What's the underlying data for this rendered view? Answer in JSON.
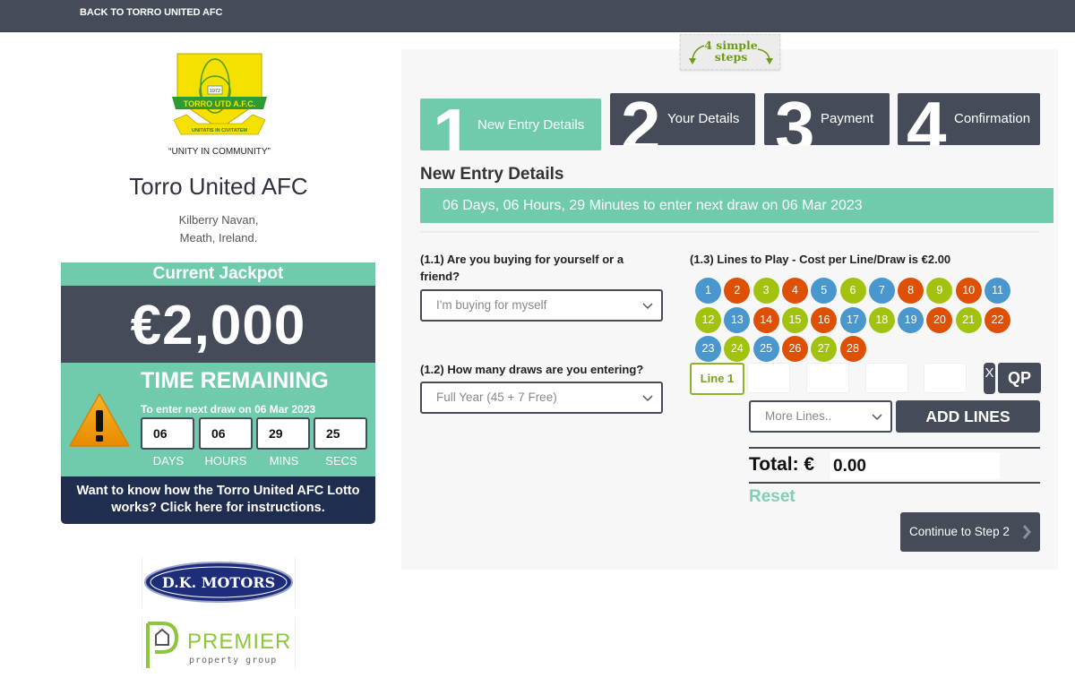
{
  "topbar": {
    "back_link": "BACK TO TORRO UNITED AFC"
  },
  "club": {
    "logo": {
      "year": "1972",
      "banner": "TORRO UTD A.F.C.",
      "motto": "UNITATIS IN CIVITATEM",
      "tagline": "“UNITY IN COMMUNITY”"
    },
    "name": "Torro United AFC",
    "address_line1": "Kilberry Navan,",
    "address_line2": "Meath, Ireland."
  },
  "jackpot": {
    "title": "Current Jackpot",
    "amount": "€2,000",
    "time_remaining_title": "TIME REMAINING",
    "next_draw_text": "To enter next draw on 06 Mar 2023",
    "countdown": [
      {
        "value": "06",
        "label": "DAYS"
      },
      {
        "value": "06",
        "label": "HOURS"
      },
      {
        "value": "29",
        "label": "MINS"
      },
      {
        "value": "25",
        "label": "SECS"
      }
    ],
    "info_link": "Want to know how the Torro United AFC Lotto works? Click here for instructions."
  },
  "sponsors": [
    {
      "name": "D.K. MOTORS"
    },
    {
      "name": "PREMIER",
      "subtitle": "property group"
    }
  ],
  "steps_badge": {
    "line1": "4 simple",
    "line2": "steps"
  },
  "steps": [
    {
      "number": "1",
      "label": "New Entry Details",
      "active": true
    },
    {
      "number": "2",
      "label": "Your Details",
      "active": false
    },
    {
      "number": "3",
      "label": "Payment",
      "active": false
    },
    {
      "number": "4",
      "label": "Confirmation",
      "active": false
    }
  ],
  "form": {
    "section_title": "New Entry Details",
    "draw_banner": "06 Days, 06 Hours, 29 Minutes to enter next draw on 06 Mar 2023",
    "q1": {
      "label": "(1.1) Are you buying for yourself or a friend?",
      "selected": "I'm buying for myself"
    },
    "q2": {
      "label": "(1.2) How many draws are you entering?",
      "selected": "Full Year (45 + 7 Free)"
    },
    "q3": {
      "label": "(1.3) Lines to Play - Cost per Line/Draw is €2.00"
    },
    "ball_colors": {
      "blue": "#4a97cd",
      "orange": "#dd5006",
      "green": "#a1c30f"
    },
    "balls": [
      {
        "n": "1",
        "c": "blue"
      },
      {
        "n": "2",
        "c": "orange"
      },
      {
        "n": "3",
        "c": "green"
      },
      {
        "n": "4",
        "c": "orange"
      },
      {
        "n": "5",
        "c": "blue"
      },
      {
        "n": "6",
        "c": "green"
      },
      {
        "n": "7",
        "c": "blue"
      },
      {
        "n": "8",
        "c": "orange"
      },
      {
        "n": "9",
        "c": "green"
      },
      {
        "n": "10",
        "c": "orange"
      },
      {
        "n": "11",
        "c": "blue"
      },
      {
        "n": "12",
        "c": "green"
      },
      {
        "n": "13",
        "c": "blue"
      },
      {
        "n": "14",
        "c": "orange"
      },
      {
        "n": "15",
        "c": "green"
      },
      {
        "n": "16",
        "c": "orange"
      },
      {
        "n": "17",
        "c": "blue"
      },
      {
        "n": "18",
        "c": "green"
      },
      {
        "n": "19",
        "c": "blue"
      },
      {
        "n": "20",
        "c": "orange"
      },
      {
        "n": "21",
        "c": "green"
      },
      {
        "n": "22",
        "c": "orange"
      },
      {
        "n": "23",
        "c": "blue"
      },
      {
        "n": "24",
        "c": "green"
      },
      {
        "n": "25",
        "c": "blue"
      },
      {
        "n": "26",
        "c": "orange"
      },
      {
        "n": "27",
        "c": "green"
      },
      {
        "n": "28",
        "c": "orange"
      }
    ],
    "line_label": "Line 1",
    "line_picks": [
      "",
      "",
      "",
      "",
      ""
    ],
    "clear_label": "X",
    "quick_pick_label": "QP",
    "more_lines_placeholder": "More Lines..",
    "add_lines_label": "ADD LINES",
    "total_label": "Total: €",
    "total_value": "0.00",
    "reset_label": "Reset",
    "continue_label": "Continue to Step 2"
  },
  "colors": {
    "accent_green": "#6fcbab",
    "dark": "#464b59",
    "navy": "#1f2d4f"
  }
}
